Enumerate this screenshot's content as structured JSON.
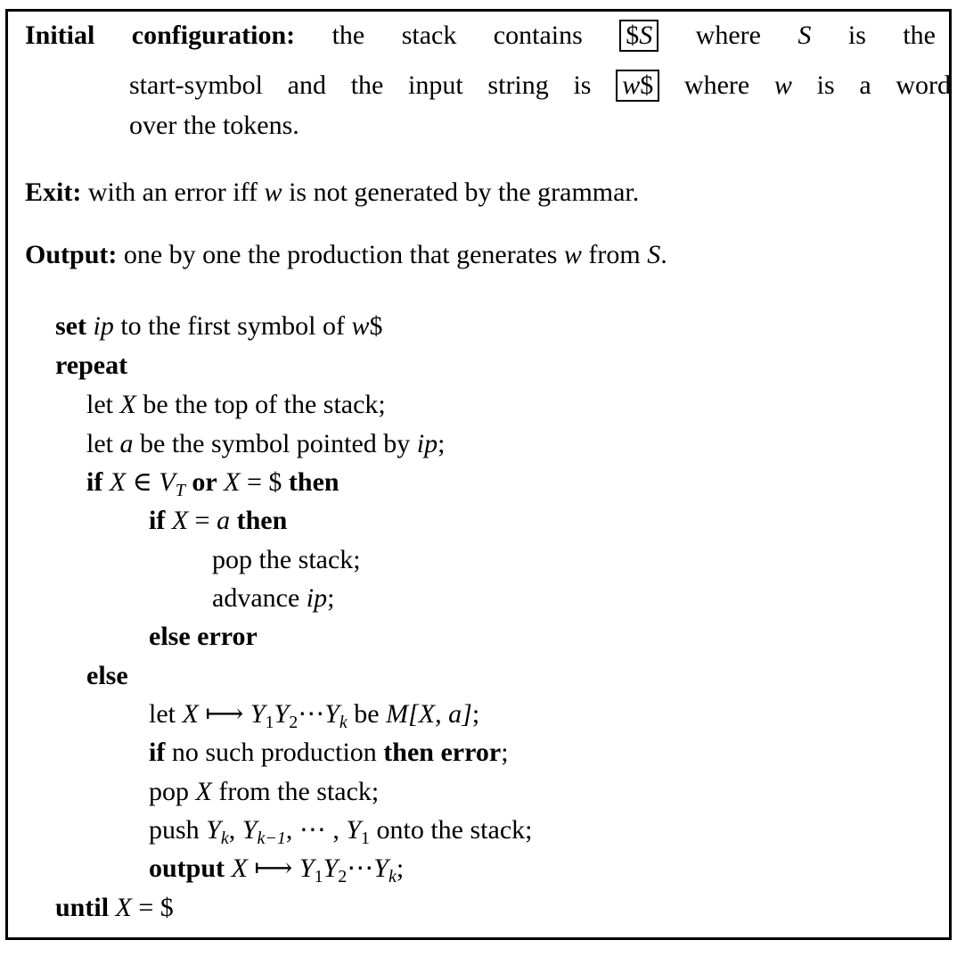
{
  "header": {
    "initial_label": "Initial configuration:",
    "initial_text_1": "the stack contains",
    "initial_box_1_a": "$",
    "initial_box_1_b": "S",
    "initial_text_2": "where",
    "initial_S": "S",
    "initial_text_3": "is the",
    "initial_text_4": "start-symbol and the input string is",
    "initial_box_2_a": "w",
    "initial_box_2_b": "$",
    "initial_text_5": "where",
    "initial_w": "w",
    "initial_text_6": "is a word",
    "initial_text_7": "over the tokens.",
    "exit_label": "Exit:",
    "exit_text_1": "with an error iff",
    "exit_w": "w",
    "exit_text_2": "is not generated by the grammar.",
    "output_label": "Output:",
    "output_text_1": "one by one the production that generates",
    "output_w": "w",
    "output_text_2": "from",
    "output_S": "S",
    "output_text_3": "."
  },
  "algorithm": {
    "l1_kw": "set",
    "l1_var": "ip",
    "l1_text": "to the first symbol of",
    "l1_w": "w",
    "l1_dollar": "$",
    "l2_kw": "repeat",
    "l3_a": "let",
    "l3_X": "X",
    "l3_b": "be the top of the stack;",
    "l4_a": "let",
    "l4_var": "a",
    "l4_b": "be the symbol pointed by",
    "l4_ip": "ip",
    "l4_c": ";",
    "l5_if": "if",
    "l5_X": "X",
    "l5_in": "∈",
    "l5_V": "V",
    "l5_T": "T",
    "l5_or": "or",
    "l5_X2": "X",
    "l5_eq": "= $",
    "l5_then": "then",
    "l6_if": "if",
    "l6_X": "X",
    "l6_eq": "=",
    "l6_a": "a",
    "l6_then": "then",
    "l7": "pop the stack;",
    "l8_a": "advance",
    "l8_ip": "ip",
    "l8_c": ";",
    "l9": "else error",
    "l10": "else",
    "l11_let": "let",
    "l11_X": "X",
    "l11_arrow": "⟼",
    "l11_Y": "Y",
    "l11_1": "1",
    "l11_Y2": "Y",
    "l11_2": "2",
    "l11_dots": "⋯",
    "l11_Yk": "Y",
    "l11_k": "k",
    "l11_be": "be",
    "l11_M": "M",
    "l11_args": "[X, a]",
    "l11_c": ";",
    "l12_if": "if",
    "l12_text": "no such production",
    "l12_then": "then error",
    "l12_c": ";",
    "l13_a": "pop",
    "l13_X": "X",
    "l13_b": "from the stack;",
    "l14_push": "push",
    "l14_Y": "Y",
    "l14_k": "k",
    "l14_comma1": ",",
    "l14_Y2": "Y",
    "l14_k1": "k−1",
    "l14_comma2": ", ⋯ ,",
    "l14_Y3": "Y",
    "l14_1": "1",
    "l14_text": "onto the stack;",
    "l15_kw": "output",
    "l15_X": "X",
    "l15_arrow": "⟼",
    "l15_Y": "Y",
    "l15_1": "1",
    "l15_Y2": "Y",
    "l15_2": "2",
    "l15_dots": "⋯",
    "l15_Yk": "Y",
    "l15_k": "k",
    "l15_c": ";",
    "l16_kw": "until",
    "l16_X": "X",
    "l16_eq": "= $"
  }
}
